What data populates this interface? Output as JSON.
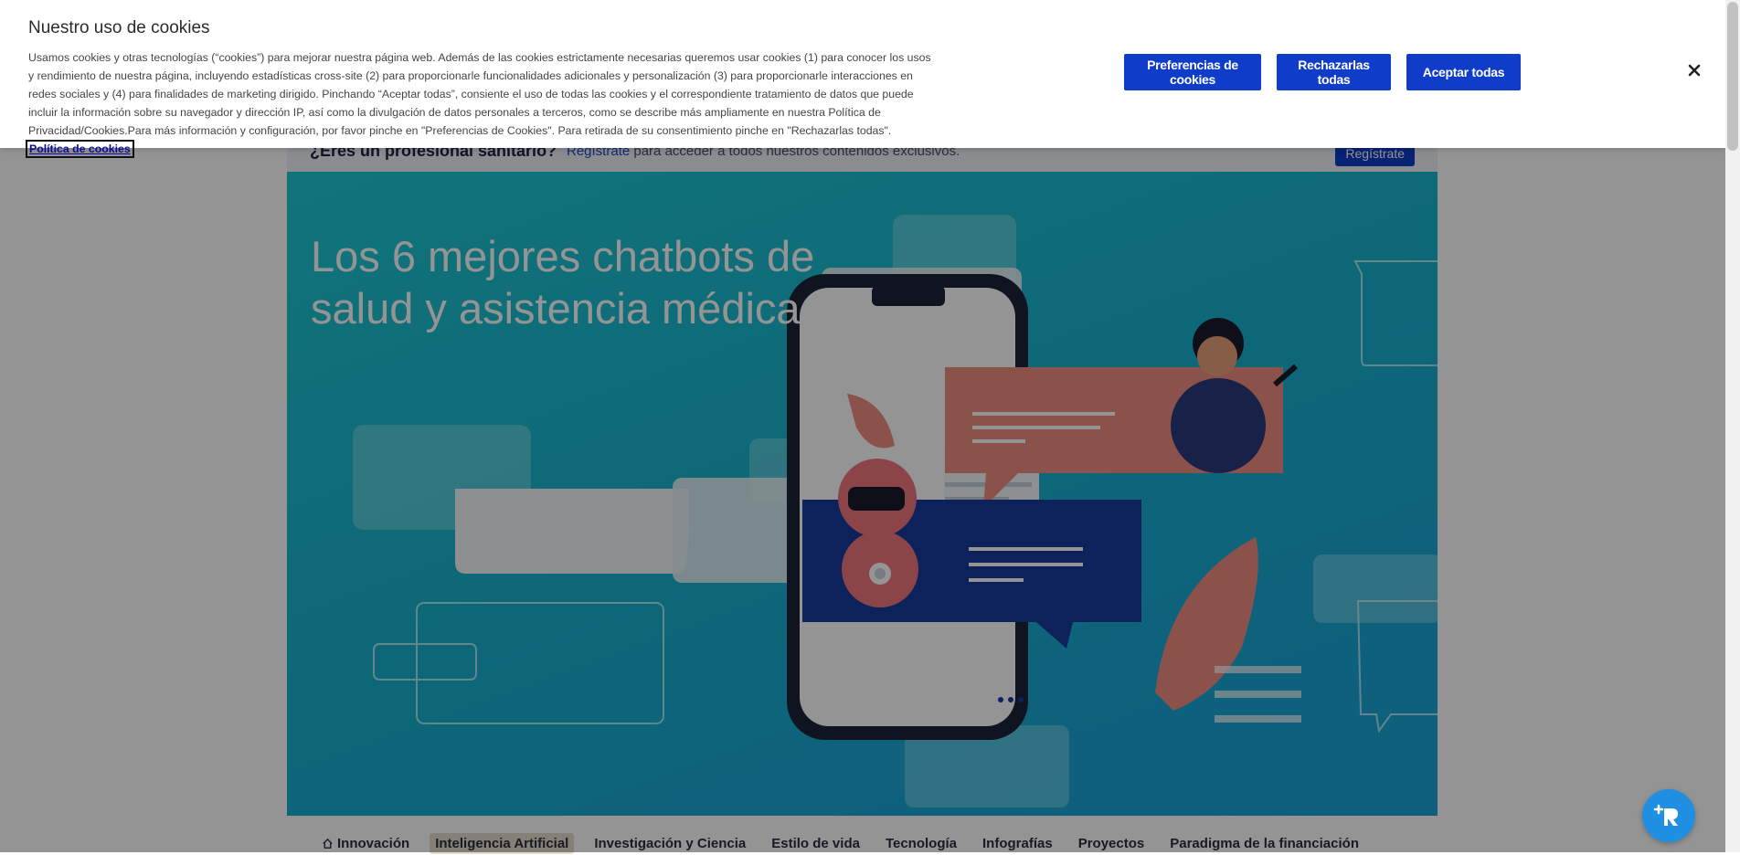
{
  "cookie_banner": {
    "title": "Nuestro uso de cookies",
    "body": "Usamos cookies y otras tecnologías (“cookies”) para mejorar nuestra página web. Además de las cookies estrictamente necesarias queremos usar cookies (1) para conocer los usos y rendimiento de nuestra página, incluyendo estadísticas cross-site (2) para proporcionarle funcionalidades adicionales y personalización (3) para proporcionarle interacciones en redes sociales y (4) para finalidades de marketing dirigido. Pinchando “Aceptar todas”, consiente el uso de todas las cookies y el correspondiente tratamiento de datos que puede incluir la información sobre su navegador y dirección IP, así como la divulgación de datos personales a terceros, como se describe más ampliamente en nuestra Política de Privacidad/Cookies.Para más información y configuración, por favor pinche en \"Preferencias de Cookies\". Para retirada de su consentimiento pinche en \"Rechazarlas todas\".",
    "policy_link": "Política de cookies",
    "buttons": {
      "preferences": "Preferencias de cookies",
      "reject": "Rechazarlas todas",
      "accept": "Aceptar todas"
    },
    "close_icon": "close-icon",
    "accent_color": "#0f3cc9"
  },
  "register_bar": {
    "question": "¿Eres un profesional sanitario?",
    "link": "Regístrate",
    "text": "para acceder a todos nuestros contenidos exclusivos.",
    "button": "Regístrate"
  },
  "hero": {
    "title": "Los 6 mejores chatbots de salud y asistencia médica"
  },
  "nav": {
    "items": [
      {
        "label": "Innovación",
        "icon": "home-icon"
      },
      {
        "label": "Inteligencia Artificial",
        "active": true
      },
      {
        "label": "Investigación y Ciencia"
      },
      {
        "label": "Estilo de vida"
      },
      {
        "label": "Tecnología"
      },
      {
        "label": "Infografías"
      },
      {
        "label": "Proyectos"
      },
      {
        "label": "Paradigma de la financiación"
      }
    ]
  },
  "fab": {
    "icon": "assistant-icon"
  }
}
